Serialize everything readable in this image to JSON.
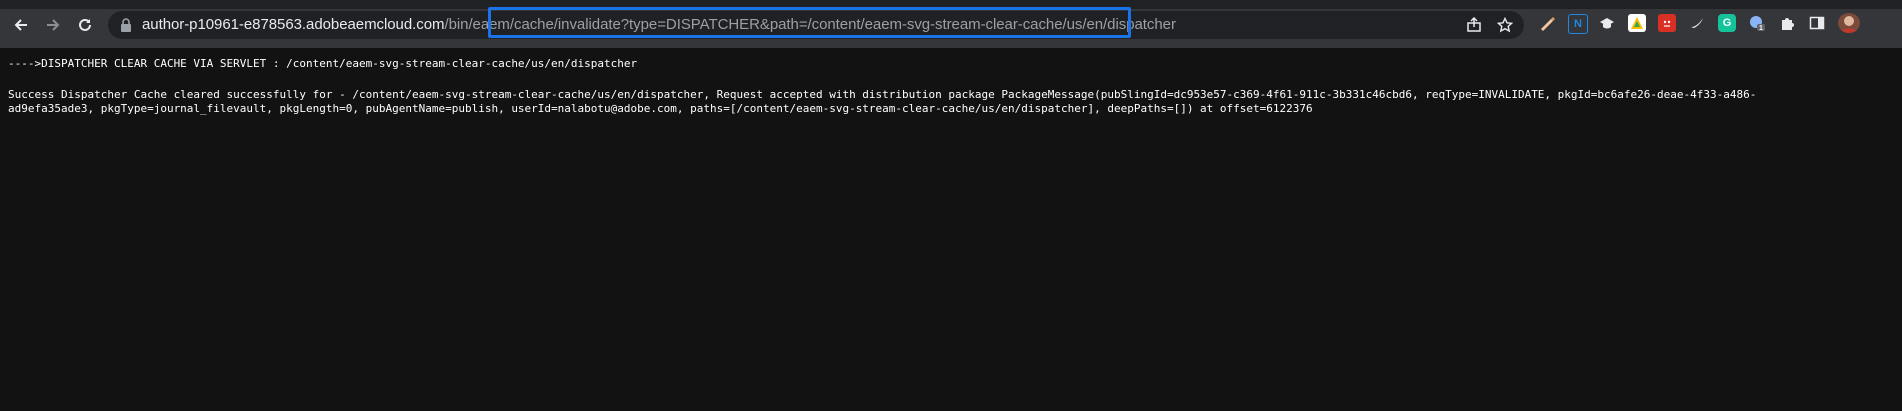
{
  "browser": {
    "url_host": "author-p10961-e878563.adobeaemcloud.com",
    "url_path": "/bin/eaem/cache/invalidate?type=DISPATCHER&path=/content/eaem-svg-stream-clear-cache/us/en/dispatcher",
    "icons": [
      "back-icon",
      "forward-icon",
      "reload-icon",
      "lock-icon",
      "share-icon",
      "star-icon"
    ],
    "extensions": [
      {
        "name": "pen-extension-icon",
        "label": "",
        "color": "#f4c7a1"
      },
      {
        "name": "n-extension-icon",
        "label": "N",
        "color": "#1e88e5"
      },
      {
        "name": "hat-extension-icon",
        "label": "",
        "color": "#e8eaed"
      },
      {
        "name": "triangle-extension-icon",
        "label": "",
        "color": "#fbbc04"
      },
      {
        "name": "red-face-extension-icon",
        "label": "",
        "color": "#d93025"
      },
      {
        "name": "bird-extension-icon",
        "label": "",
        "color": "#e8eaed"
      },
      {
        "name": "g-extension-icon",
        "label": "G",
        "color": "#15c39a"
      },
      {
        "name": "globe-extension-icon",
        "label": "",
        "color": "#8ab4f8",
        "badge": "1"
      },
      {
        "name": "puzzle-extensions-icon",
        "label": "",
        "color": "#e8eaed"
      },
      {
        "name": "sidepanel-icon",
        "label": "",
        "color": "#e8eaed"
      },
      {
        "name": "profile-avatar",
        "label": "",
        "color": "#c0392b"
      }
    ]
  },
  "page": {
    "line1": "---->DISPATCHER CLEAR CACHE VIA SERVLET : /content/eaem-svg-stream-clear-cache/us/en/dispatcher",
    "line2": "Success Dispatcher Cache cleared successfully for - /content/eaem-svg-stream-clear-cache/us/en/dispatcher, Request accepted with distribution package PackageMessage(pubSlingId=dc953e57-c369-4f61-911c-3b331c46cbd6, reqType=INVALIDATE, pkgId=bc6afe26-deae-4f33-a486-",
    "line3": "ad9efa35ade3, pkgType=journal_filevault, pkgLength=0, pubAgentName=publish, userId=nalabotu@adobe.com, paths=[/content/eaem-svg-stream-clear-cache/us/en/dispatcher], deepPaths=[]) at offset=6122376"
  }
}
